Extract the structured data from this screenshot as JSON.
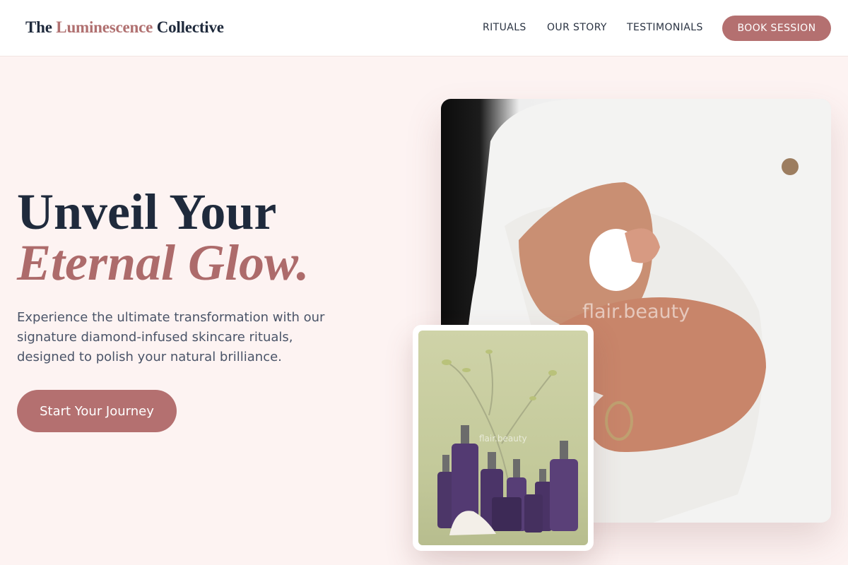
{
  "brand": {
    "name_part1": "The ",
    "name_accent": "Luminescence",
    "name_part2": " Collective"
  },
  "nav": {
    "links": [
      "RITUALS",
      "OUR STORY",
      "TESTIMONIALS"
    ],
    "cta_label": "BOOK SESSION"
  },
  "hero": {
    "title_line1": "Unveil Your",
    "title_line2": "Eternal Glow.",
    "description": "Experience the ultimate transformation with our signature diamond-infused skincare rituals, designed to polish your natural brilliance.",
    "cta_label": "Start Your Journey"
  },
  "images": {
    "main_watermark": "flair.beauty",
    "small_watermark": "flair.beauty"
  },
  "colors": {
    "accent": "#b47070",
    "heading": "#1f2a3c",
    "background": "#fdf3f2"
  }
}
